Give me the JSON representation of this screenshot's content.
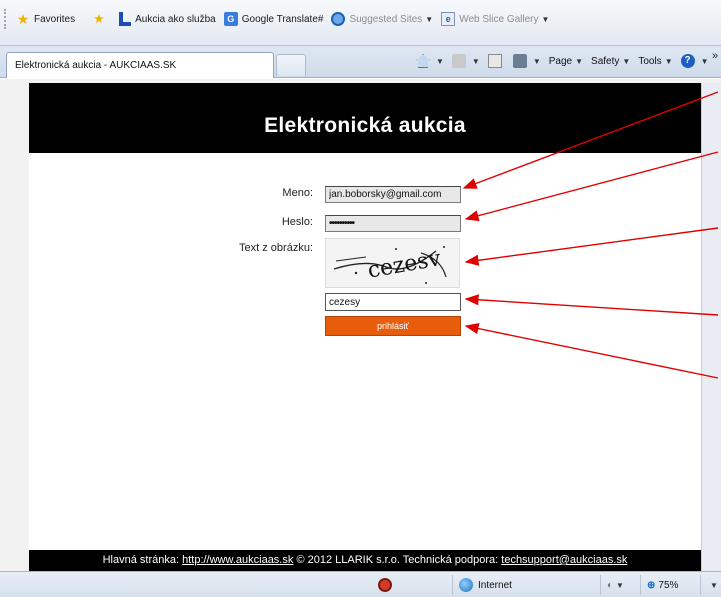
{
  "favorites_bar": {
    "favorites_label": "Favorites",
    "items": [
      {
        "label": "Aukcia ako služba",
        "icon": "blue-l-icon"
      },
      {
        "label": "Google Translate#",
        "icon": "translate-icon"
      },
      {
        "label": "Suggested Sites",
        "icon": "ie-icon"
      },
      {
        "label": "Web Slice Gallery",
        "icon": "web-slice-icon"
      }
    ]
  },
  "tab": {
    "title": "Elektronická aukcia - AUKCIAAS.SK"
  },
  "command_bar": {
    "page": "Page",
    "safety": "Safety",
    "tools": "Tools",
    "more": "»"
  },
  "page": {
    "heading": "Elektronická aukcia",
    "form": {
      "meno_label": "Meno:",
      "meno_value": "jan.boborsky@gmail.com",
      "heslo_label": "Heslo:",
      "heslo_value": "••••••••••",
      "captcha_label": "Text z obrázku:",
      "captcha_text": "cezesv",
      "captcha_input_value": "cezesy",
      "login_button": "prihlásiť"
    },
    "footer": {
      "home_label": "Hlavná stránka:",
      "home_url": "http://www.aukciaas.sk",
      "copyright": "© 2012 LLARIK s.r.o.",
      "support_label": "Technická podpora:",
      "support_email": "techsupport@aukciaas.sk"
    }
  },
  "status_bar": {
    "zone": "Internet",
    "zoom": "75%"
  },
  "colors": {
    "header_bg": "#000000",
    "button_orange": "#e85d0c",
    "arrow_red": "#e00000"
  }
}
